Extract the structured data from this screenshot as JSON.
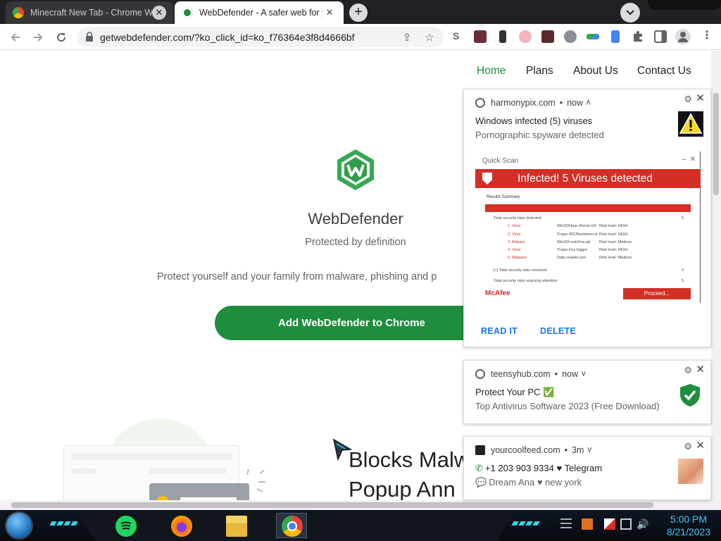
{
  "browser": {
    "tabs": [
      {
        "title": "Minecraft New Tab - Chrome We",
        "active": false
      },
      {
        "title": "WebDefender - A safer web for y",
        "active": true
      }
    ],
    "url": "getwebdefender.com/?ko_click_id=ko_f76364e3f8d4666bf",
    "new_tab_label": "+",
    "close_tab_glyph": "✕"
  },
  "site": {
    "nav": [
      "Home",
      "Plans",
      "About Us",
      "Contact Us"
    ],
    "brand_name": "WebDefender",
    "tagline": "Protected by definition",
    "protect_text": "Protect yourself and your family from malware, phishing and p",
    "cta": "Add WebDefender to Chrome",
    "section_title_1": "Blocks Malw",
    "section_title_2": "Popup Ann",
    "brand_color": "#1e8e3e"
  },
  "notifications": [
    {
      "source": "harmonypix.com",
      "time": "now",
      "title": "Windows infected (5) viruses",
      "body": "Pornographic spyware detected",
      "image": {
        "window_title": "Quick Scan",
        "headline": "Infected! 5 Viruses detected",
        "summary_label": "Results Summary",
        "total_label": "Total security risks detected:",
        "total_value": "5",
        "rows": [
          {
            "n": "1. Virus",
            "name": "Win32/Hoax.Rensir.HX",
            "level": "Risk level: HIGH"
          },
          {
            "n": "2. Virus",
            "name": "Trojan.IRC/Backdoor.rd",
            "level": "Risk level: HIGH"
          },
          {
            "n": "3. Adware",
            "name": "Win32/Look2me.ab",
            "level": "Risk level: Medium"
          },
          {
            "n": "4. Virus",
            "name": "Trojan.Key logger",
            "level": "Risk level: HIGH"
          },
          {
            "n": "5. Malware",
            "name": "Data.crawler.exe",
            "level": "Risk level: Medium"
          }
        ],
        "resolved_label": "[+] Total security risks resolved:",
        "resolved_value": "0",
        "attention_label": "Total security risks requiring attention:",
        "attention_value": "5",
        "logo": "McAfee",
        "button": "Proceed..."
      },
      "actions": [
        "READ IT",
        "DELETE"
      ]
    },
    {
      "source": "teensyhub.com",
      "time": "now",
      "title": "Protect Your PC ✅",
      "body": "Top Antivirus Software 2023 (Free Download)"
    },
    {
      "source": "yourcoolfeed.com",
      "time": "3m",
      "title": "+1 203 903 9334 ♥ Telegram",
      "body": "Dream Ana ♥ new york"
    }
  ],
  "taskbar": {
    "time": "5:00 PM",
    "date": "8/21/2023",
    "accent": "#3ec7ff"
  }
}
